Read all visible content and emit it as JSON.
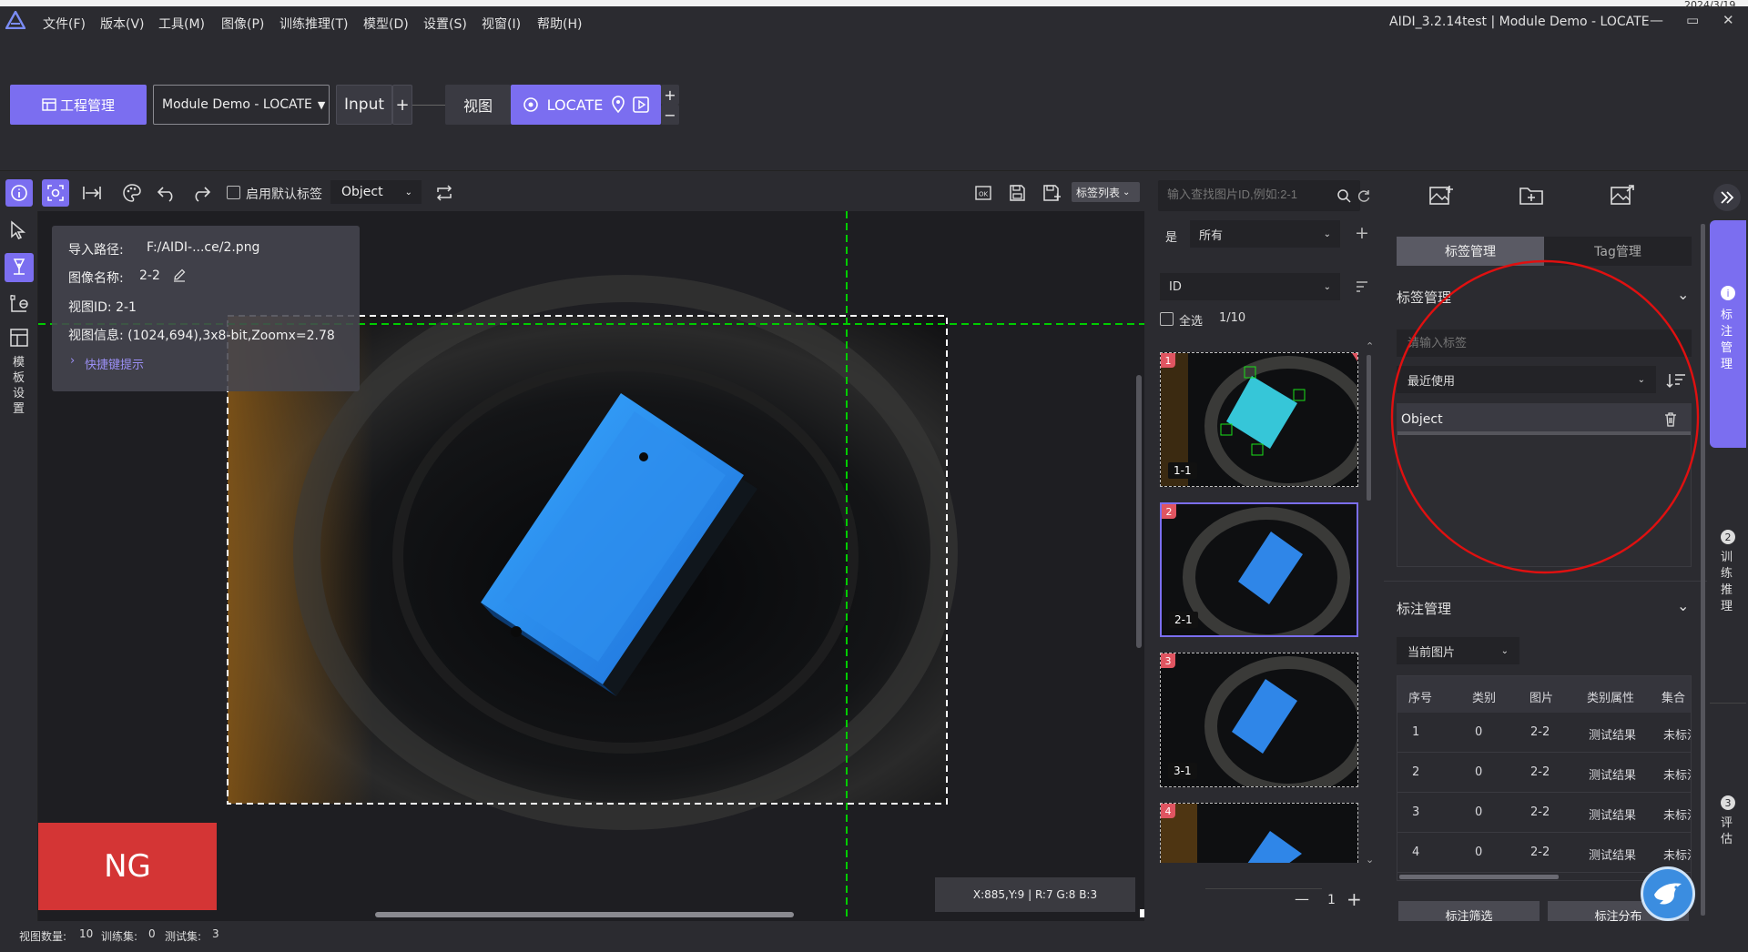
{
  "window": {
    "date_stub": "2024/3/19",
    "title": "AIDI_3.2.14test | Module Demo - LOCATE",
    "min_label": "—",
    "max_label": "▭",
    "close_label": "✕"
  },
  "menu": [
    "文件(F)",
    "版本(V)",
    "工具(M)",
    "图像(P)",
    "训练推理(T)",
    "模型(D)",
    "设置(S)",
    "视窗(I)",
    "帮助(H)"
  ],
  "pipeline": {
    "project_button": "工程管理",
    "module_select": "Module Demo - LOCATE",
    "input_label": "Input",
    "view_label": "视图",
    "locate_label": "LOCATE"
  },
  "toolbar": {
    "default_label_text": "启用默认标签",
    "label_select": "Object",
    "label_list": "标签列表"
  },
  "side_settings": "模板设置",
  "info": {
    "import_path_key": "导入路径:",
    "import_path_val": "F:/AIDI-...ce/2.png",
    "image_name_key": "图像名称:",
    "image_name_val": "2-2",
    "view_id": "视图ID: 2-1",
    "view_info": "视图信息: (1024,694),3x8-bit,Zoomx=2.78",
    "shortcut_hint": "快捷键提示"
  },
  "result": {
    "label": "NG",
    "color": "#d43535"
  },
  "pixel_readout": "X:885,Y:9 | R:7 G:8 B:3",
  "search": {
    "placeholder": "输入查找图片ID,例如:2-1"
  },
  "filter": {
    "key": "是",
    "value": "所有"
  },
  "sort": {
    "value": "ID"
  },
  "select_all": {
    "label": "全选",
    "count": "1/10"
  },
  "thumbnails": [
    {
      "num": "1",
      "label": "1-1"
    },
    {
      "num": "2",
      "label": "2-1"
    },
    {
      "num": "3",
      "label": "3-1"
    },
    {
      "num": "4",
      "label": ""
    }
  ],
  "pager": {
    "minus": "—",
    "page": "1",
    "plus": "+"
  },
  "right": {
    "tab_active": "标签管理",
    "tab_other": "Tag管理",
    "label_section": "标签管理",
    "label_input_placeholder": "请输入标签",
    "sort_select": "最近使用",
    "label_item": "Object",
    "annotation_section": "标注管理",
    "scope_select": "当前图片",
    "table": {
      "headers": [
        "序号",
        "类别",
        "图片",
        "类别属性",
        "集合"
      ],
      "rows": [
        [
          "1",
          "0",
          "2-2",
          "测试结果",
          "未标注"
        ],
        [
          "2",
          "0",
          "2-2",
          "测试结果",
          "未标注"
        ],
        [
          "3",
          "0",
          "2-2",
          "测试结果",
          "未标注"
        ],
        [
          "4",
          "0",
          "2-2",
          "测试结果",
          "未标注"
        ]
      ]
    },
    "filter_button": "标注筛选",
    "dist_button": "标注分布"
  },
  "rail": [
    {
      "num": "i",
      "text": "标注管理"
    },
    {
      "num": "2",
      "text": "训练推理"
    },
    {
      "num": "3",
      "text": "评估"
    }
  ],
  "status": {
    "view_count_key": "视图数量:",
    "view_count": "10",
    "train_key": "训练集:",
    "train_count": "0",
    "test_key": "测试集:",
    "test_count": "3"
  },
  "colors": {
    "accent": "#7b6ef0",
    "ng": "#d43535",
    "guide": "#00cc00",
    "annotation_circle": "#e01010"
  }
}
